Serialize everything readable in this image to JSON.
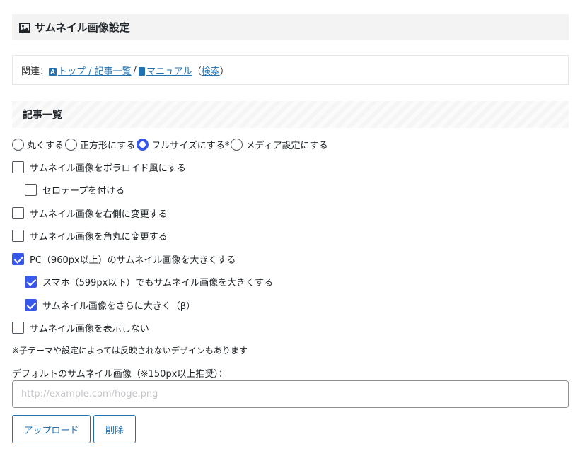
{
  "header": {
    "title": "サムネイル画像設定",
    "icon": "image-icon"
  },
  "related": {
    "prefix": "関連：",
    "link1_icon": "A",
    "link1": "トップ / 記事一覧",
    "separator": "/",
    "link2": "マニュアル",
    "open_paren": "（",
    "link3": "検索",
    "close_paren": "）"
  },
  "section": {
    "title": "記事一覧"
  },
  "shape_options": [
    {
      "label": "丸くする",
      "checked": false
    },
    {
      "label": "正方形にする",
      "checked": false
    },
    {
      "label": "フルサイズにする*",
      "checked": true
    },
    {
      "label": "メディア設定にする",
      "checked": false
    }
  ],
  "checkboxes": {
    "polaroid": {
      "label": "サムネイル画像をポラロイド風にする",
      "checked": false
    },
    "tape": {
      "label": "セロテープを付ける",
      "checked": false
    },
    "right": {
      "label": "サムネイル画像を右側に変更する",
      "checked": false
    },
    "rounded": {
      "label": "サムネイル画像を角丸に変更する",
      "checked": false
    },
    "pc_large": {
      "label": "PC（960px以上）のサムネイル画像を大きくする",
      "checked": true
    },
    "sp_large": {
      "label": "スマホ（599px以下）でもサムネイル画像を大きくする",
      "checked": true
    },
    "larger": {
      "label": "サムネイル画像をさらに大きく（β）",
      "checked": true
    },
    "hide": {
      "label": "サムネイル画像を表示しない",
      "checked": false
    }
  },
  "note": "※子テーマや設定によっては反映されないデザインもあります",
  "default_image": {
    "label": "デフォルトのサムネイル画像（※150px以上推奨）：",
    "value": "",
    "placeholder": "http://example.com/hoge.png"
  },
  "buttons": {
    "upload": "アップロード",
    "delete": "削除"
  },
  "colors": {
    "accent": "#3858e9",
    "link": "#2271b1"
  }
}
